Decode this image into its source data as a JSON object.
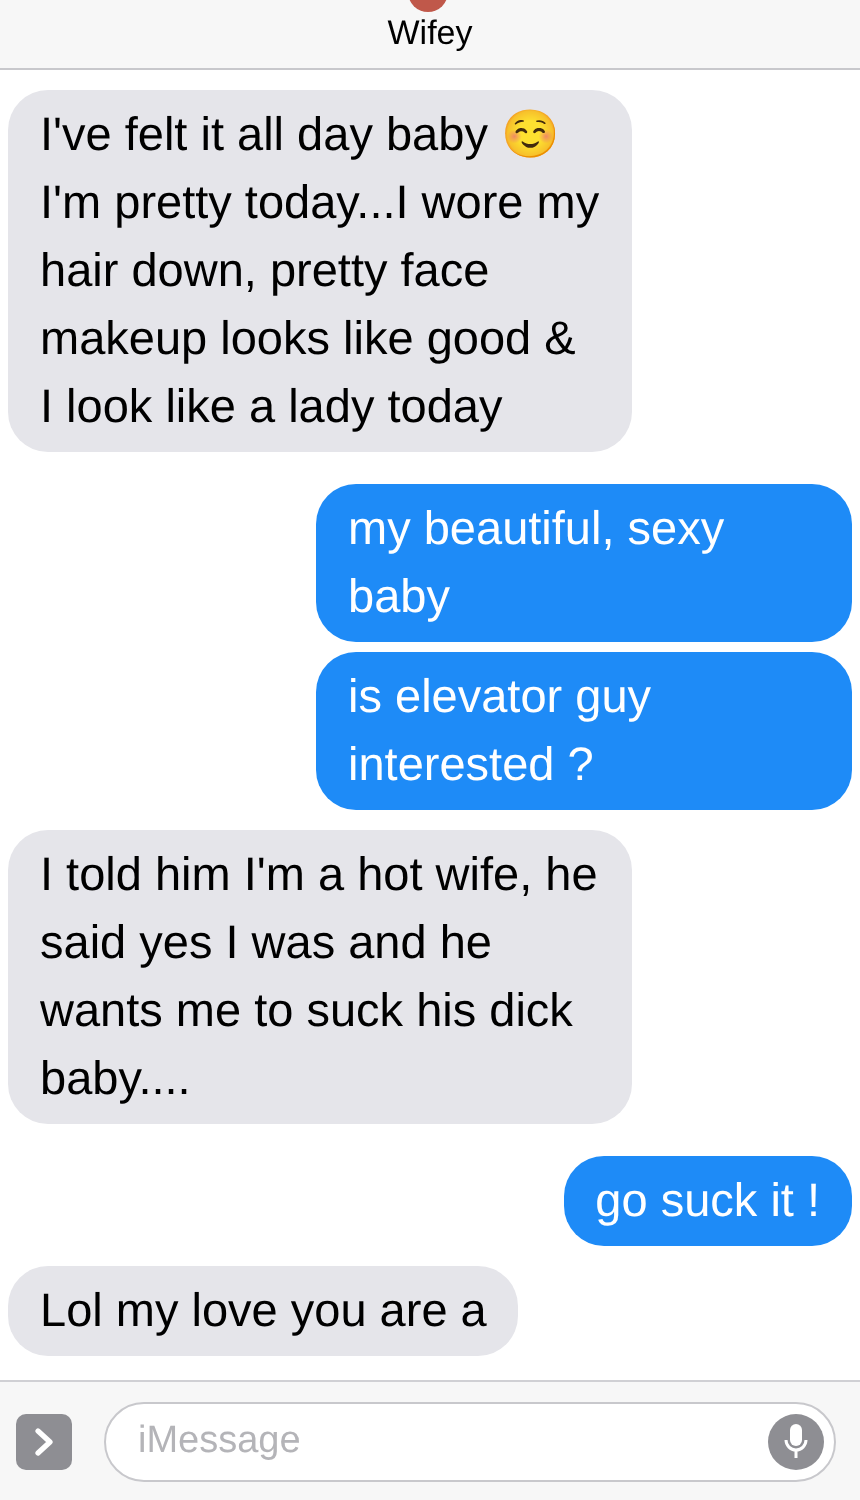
{
  "header": {
    "contact_name": "Wifey"
  },
  "messages": [
    {
      "kind": "received",
      "text": "I've felt it all day baby ☺️ I'm pretty today...I wore my hair down, pretty face makeup looks like good & I look like a lady today"
    },
    {
      "kind": "sent",
      "text": "my beautiful, sexy baby"
    },
    {
      "kind": "sent",
      "text": "is elevator guy interested ?"
    },
    {
      "kind": "received",
      "text": "I told him I'm a hot wife, he said yes I was and he wants me to suck his dick baby...."
    },
    {
      "kind": "sent",
      "text": "go suck it !"
    },
    {
      "kind": "received",
      "text": "Lol my love you are a"
    }
  ],
  "composer": {
    "placeholder": "iMessage"
  }
}
